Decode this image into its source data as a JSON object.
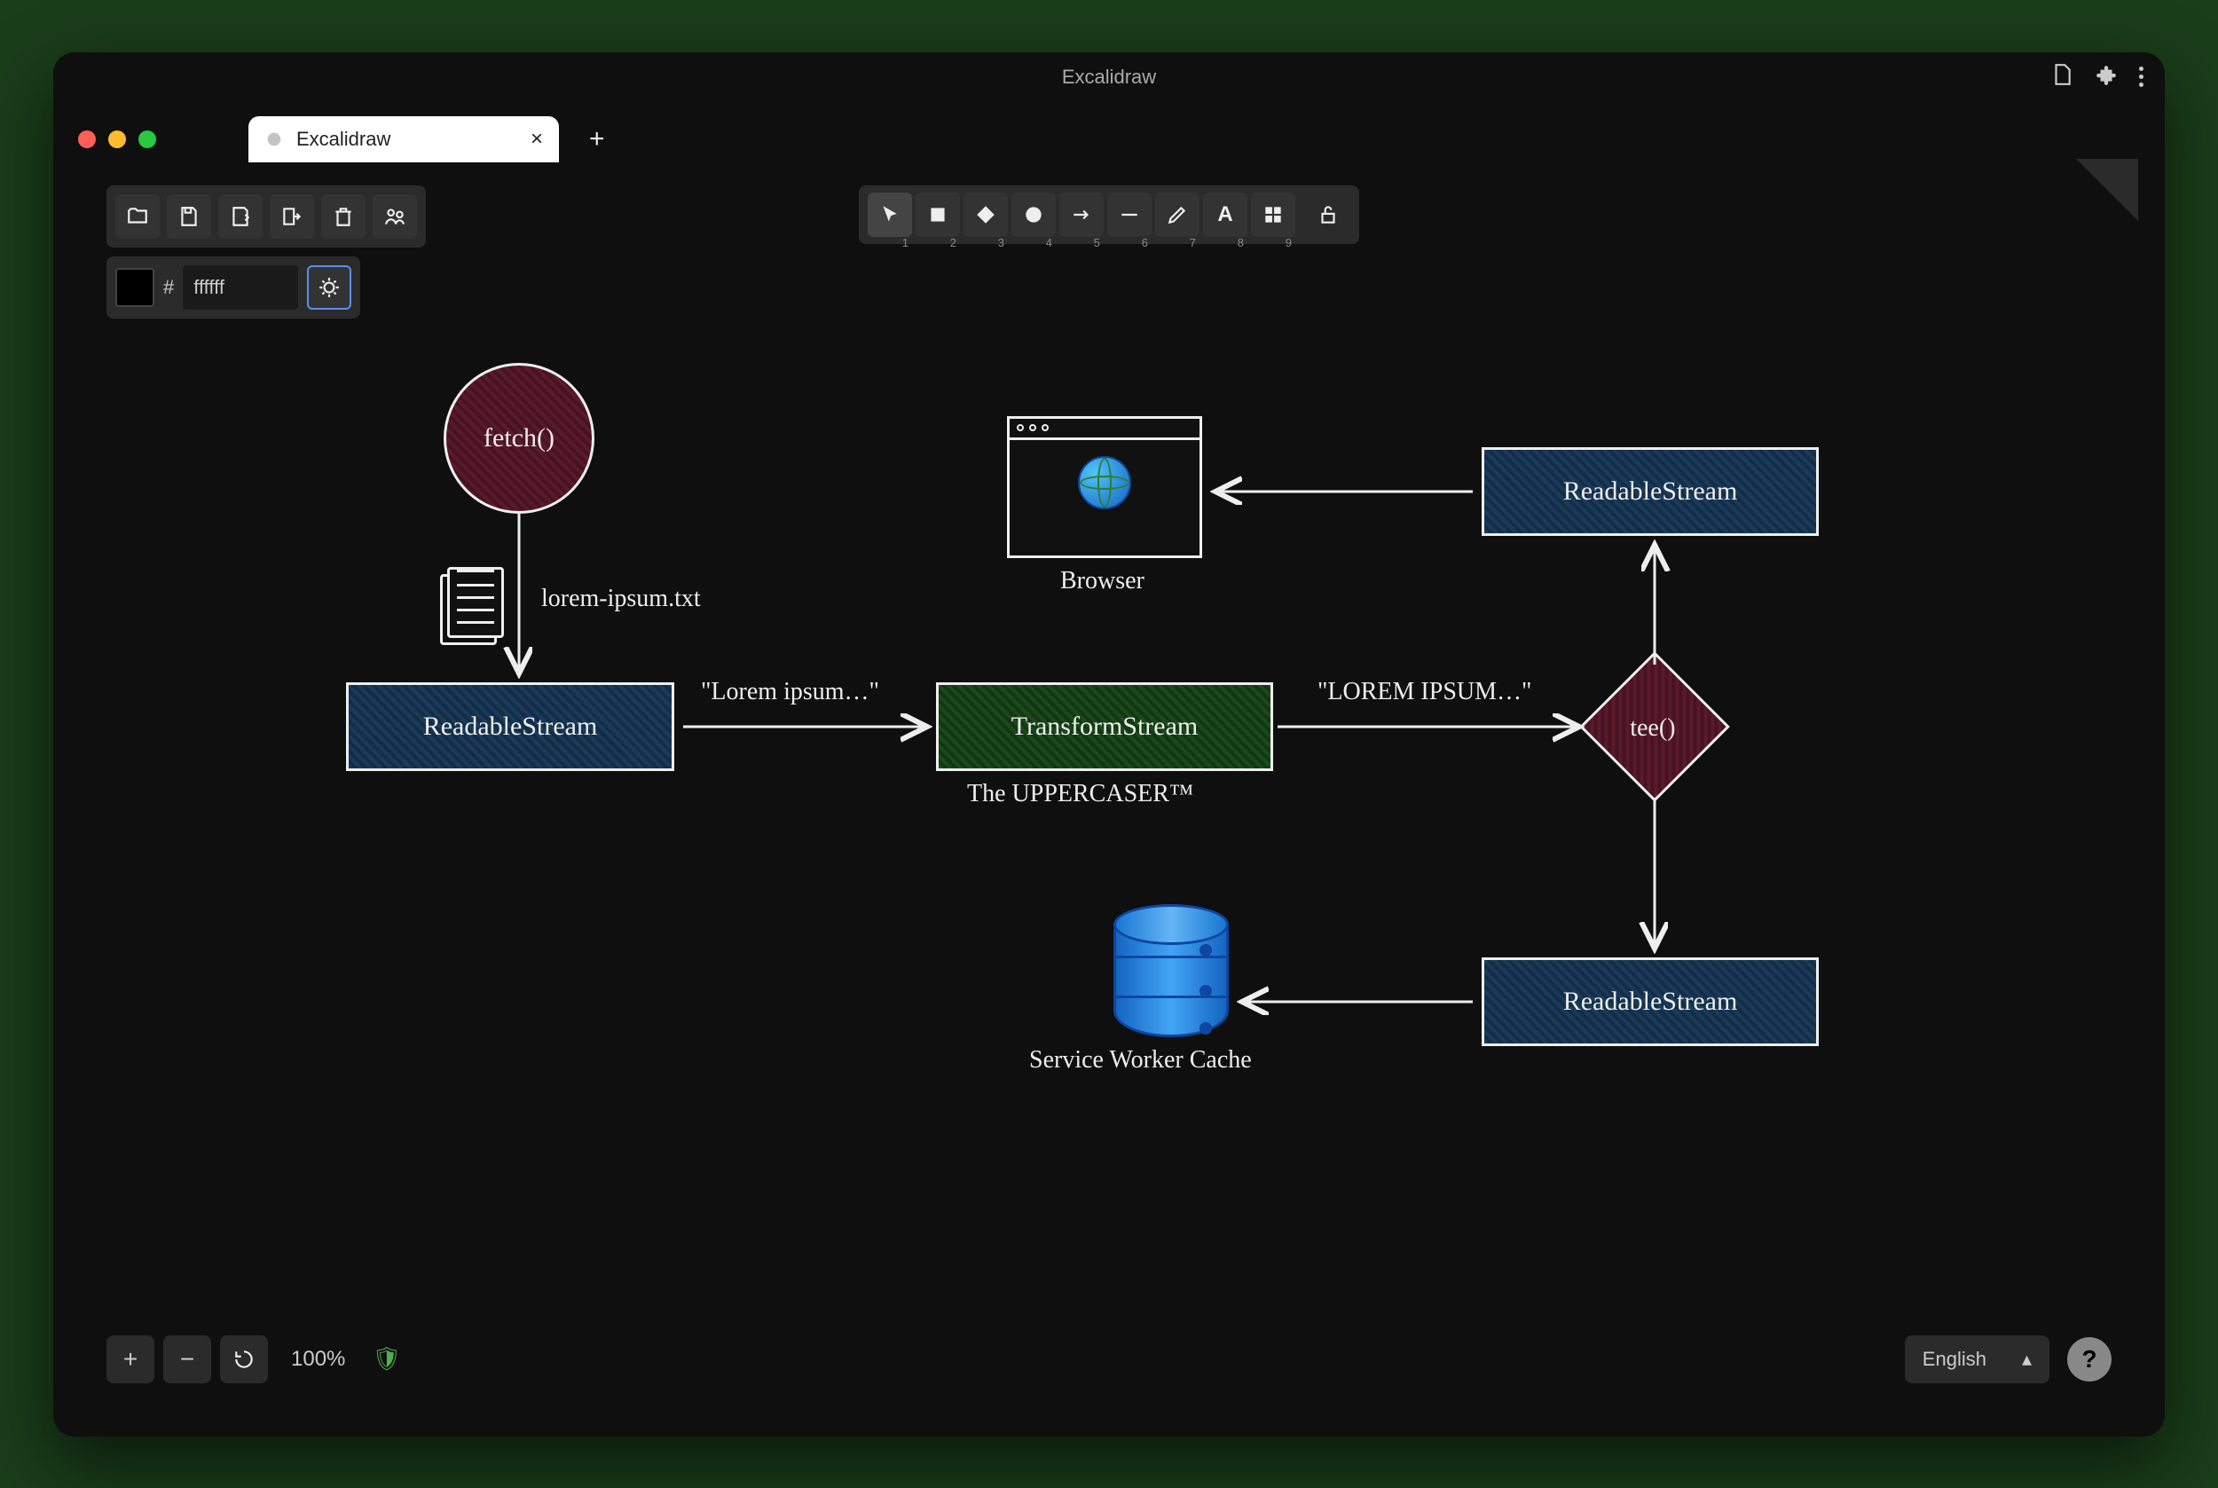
{
  "titlebar": {
    "app_title": "Excalidraw"
  },
  "tab": {
    "title": "Excalidraw"
  },
  "color_field": {
    "value": "ffffff",
    "prefix": "#"
  },
  "tools": {
    "indices": [
      "1",
      "2",
      "3",
      "4",
      "5",
      "6",
      "7",
      "8",
      "9"
    ]
  },
  "statusbar": {
    "zoom": "100%",
    "language": "English"
  },
  "chart_data": {
    "type": "flowchart",
    "nodes": [
      {
        "id": "fetch",
        "shape": "circle",
        "label": "fetch()",
        "fill": "crimson"
      },
      {
        "id": "file",
        "shape": "document",
        "label": "lorem-ipsum.txt"
      },
      {
        "id": "readable1",
        "shape": "rect",
        "label": "ReadableStream",
        "fill": "blue"
      },
      {
        "id": "transform",
        "shape": "rect",
        "label": "TransformStream",
        "fill": "green",
        "subtitle": "The UPPERCASER™"
      },
      {
        "id": "tee",
        "shape": "diamond",
        "label": "tee()",
        "fill": "crimson"
      },
      {
        "id": "readable2",
        "shape": "rect",
        "label": "ReadableStream",
        "fill": "blue"
      },
      {
        "id": "readable3",
        "shape": "rect",
        "label": "ReadableStream",
        "fill": "blue"
      },
      {
        "id": "browser",
        "shape": "browser",
        "label": "Browser"
      },
      {
        "id": "cache",
        "shape": "cylinder",
        "label": "Service Worker Cache"
      }
    ],
    "edges": [
      {
        "from": "fetch",
        "to": "readable1",
        "via_label": "lorem-ipsum.txt"
      },
      {
        "from": "readable1",
        "to": "transform",
        "label": "\"Lorem ipsum…\""
      },
      {
        "from": "transform",
        "to": "tee",
        "label": "\"LOREM IPSUM…\""
      },
      {
        "from": "tee",
        "to": "readable2"
      },
      {
        "from": "tee",
        "to": "readable3"
      },
      {
        "from": "readable2",
        "to": "browser"
      },
      {
        "from": "readable3",
        "to": "cache"
      }
    ]
  }
}
